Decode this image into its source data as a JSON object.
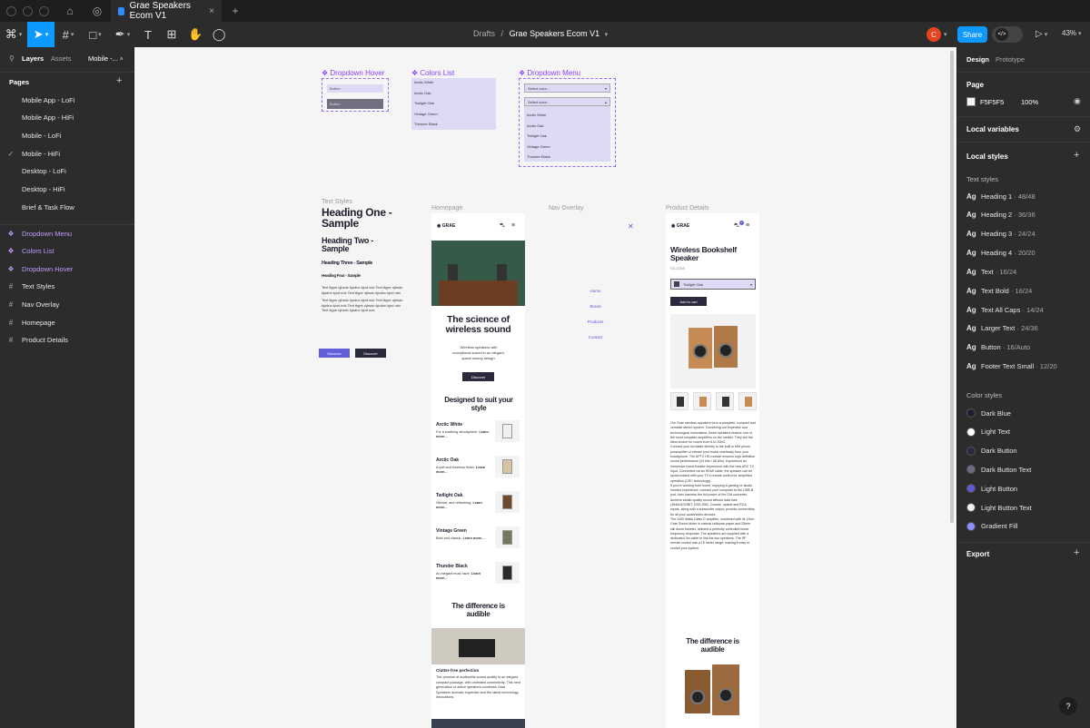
{
  "titlebar": {
    "tab_title": "Grae Speakers Ecom V1"
  },
  "toolbar": {
    "breadcrumb_parent": "Drafts",
    "breadcrumb_sep": "/",
    "file_name": "Grae Speakers Ecom V1",
    "avatar": "C",
    "share": "Share",
    "zoom": "43%"
  },
  "left": {
    "tabs": [
      "Layers",
      "Assets"
    ],
    "page_select": "Mobile -...",
    "pages_title": "Pages",
    "pages": [
      "Mobile App - LoFi",
      "Mobile App - HiFi",
      "Mobile - LoFi",
      "Mobile - HiFi",
      "Desktop - LoFi",
      "Desktop - HiFi",
      "Brief & Task Flow"
    ],
    "check": "✓",
    "layers": [
      {
        "label": "Dropdown Menu",
        "icon": "component-icon",
        "glyph": "❖",
        "purple": true
      },
      {
        "label": "Colors List",
        "icon": "component-icon",
        "glyph": "❖",
        "purple": true
      },
      {
        "label": "Dropdown Hover",
        "icon": "component-icon",
        "glyph": "❖",
        "purple": true
      },
      {
        "label": "Text Styles",
        "icon": "frame-icon",
        "glyph": "#",
        "purple": false
      },
      {
        "label": "Nav Overlay",
        "icon": "frame-icon",
        "glyph": "#",
        "purple": false
      },
      {
        "label": "Homepage",
        "icon": "frame-icon",
        "glyph": "#",
        "purple": false
      },
      {
        "label": "Product Details",
        "icon": "frame-icon",
        "glyph": "#",
        "purple": false
      }
    ]
  },
  "right": {
    "tabs": [
      "Design",
      "Prototype"
    ],
    "page_title": "Page",
    "page_color": "F5F5F5",
    "page_opacity": "100%",
    "local_variables": "Local variables",
    "local_styles": "Local styles",
    "text_styles_title": "Text styles",
    "text_styles": [
      {
        "name": "Heading 1",
        "spec": "48/48"
      },
      {
        "name": "Heading 2",
        "spec": "36/36"
      },
      {
        "name": "Heading 3",
        "spec": "24/24"
      },
      {
        "name": "Heading 4",
        "spec": "20/20"
      },
      {
        "name": "Text",
        "spec": "16/24"
      },
      {
        "name": "Text Bold",
        "spec": "16/24"
      },
      {
        "name": "Text All Caps",
        "spec": "14/24"
      },
      {
        "name": "Larger Text",
        "spec": "24/36"
      },
      {
        "name": "Button",
        "spec": "16/Auto"
      },
      {
        "name": "Footer Text Small",
        "spec": "12/20"
      }
    ],
    "ag": "Ag",
    "color_styles_title": "Color styles",
    "color_styles": [
      {
        "name": "Dark Blue",
        "color": "#1e1e2e"
      },
      {
        "name": "Light Text",
        "color": "#ffffff"
      },
      {
        "name": "Dark Button",
        "color": "#2a2a3c"
      },
      {
        "name": "Dark Button Text",
        "color": "#6b6b80"
      },
      {
        "name": "Light Button",
        "color": "#5b5bd6"
      },
      {
        "name": "Light Button Text",
        "color": "#f0f0f5"
      },
      {
        "name": "Gradient Fill",
        "color": "#8d8dff"
      }
    ],
    "export": "Export",
    "help": "?"
  },
  "canvas": {
    "components": {
      "dropdown_hover": "Dropdown Hover",
      "colors_list": "Colors List",
      "dropdown_menu": "Dropdown Menu",
      "button": "Button",
      "colors": [
        "Arctic White",
        "Arctic Oak",
        "Twilight Oak",
        "Vintage Green",
        "Thunder Black"
      ],
      "select": "Select color..."
    },
    "frames": {
      "text_styles": "Text Styles",
      "homepage": "Homepage",
      "nav_overlay": "Nav Overlay",
      "product_details": "Product Details"
    },
    "text_styles": {
      "h1": "Heading One - Sample",
      "h2": "Heading Two - Sample",
      "h3": "Heading Three - Sample",
      "h4": "Heading Four - Sample",
      "body1": "Text ttype ujhsdc kjudnc kjnd ndc Text ttype ujhsdc kjudnc kjnd ndc Text ttype ujhsdc kjudnc kjnd ndc",
      "body2": "Text ttype ujhsdc kjudnc kjnd ndc Text ttype ujhsdc kjudnc kjnd ndc Text ttype ujhsdc kjudnc kjnd ndc Text ttype ujhsdc kjudnc kjnd ndc",
      "btn": "Discover"
    },
    "home": {
      "logo": "GRAE",
      "hero_title": "The science of wireless sound",
      "hero_text": "Wireless speakers with exceptional sound in an elegant, space saving design.",
      "cta": "Discover",
      "section_title": "Designed to suit your style",
      "products": [
        {
          "name": "Arctic White",
          "desc": "For a soothing atmosphere.",
          "link": "Learn more..."
        },
        {
          "name": "Arctic Oak",
          "desc": "A soft and timeless finish.",
          "link": "Learn more..."
        },
        {
          "name": "Twilight Oak",
          "desc": "Vibrant, and refreshing.",
          "link": "Learn more..."
        },
        {
          "name": "Vintage Green",
          "desc": "Bold and classic.",
          "link": "Learn more..."
        },
        {
          "name": "Thunder Black",
          "desc": "An elegant must have.",
          "link": "Learn more..."
        }
      ],
      "diff_title": "The difference is audible",
      "feature_title": "Clutter-free perfection",
      "feature_text": "The promise of audiophile sound quality in an elegant, compact package, with unlimited connectivity. This next generation of active speakers combines Grae Speakers acoustic expertise and the latest technology innovations."
    },
    "nav": {
      "close": "✕",
      "items": [
        "Home",
        "Brand",
        "Products",
        "Contact"
      ]
    },
    "product": {
      "logo": "GRAE",
      "cart_count": "0",
      "title": "Wireless Bookshelf Speaker",
      "sku": "GS-12345",
      "select": "Twilight Oak",
      "add": "Add to cart",
      "p1": "Our Grae wireless speakers form a complete, compact and versatile stereo system. Combining our expertise and technological innovations, these speakers feature one of the most complete amplifiers on the market. They are the ideal choice for rooms from 8 to 20m2.",
      "p2": "Connect your turntable directly to the built in MM phono preamplifier or stream your music wirelessly from your smartphone. The APTX HD module ensures high definition sound performance (24 bits / 48 kHz). Experience an immersive home theater experience with the new ARC TV input. Connected via an HDMI cable, the speaker can be synchronized with your TV's remote control for simplified operation (CEC technology).",
      "p3": "If you're working from home, enjoying a gaming or studio monitor experience, connect your computer to the USB-B port, then harness the full power of the D/A converter. Achieve studio-quality sound without data loss (384kHZ/32BIT, DSD 256). Coaxial, optical and RCA inputs, along with a subwoofer output, provide connectivity for all your audio/video devices.",
      "p4": "The 2x50 Watts Class D amplifier, combined with its 13cm Grae Sound driver in natural cellulose paper and 25mm silk dome tweeter, delivers a perfectly controlled linear frequency response. The speakers are supplied with a dedicated 3m cable to link the two speakers. The RF remote control has a 15 meter range, making it easy to control your system.",
      "diff_title": "The difference is audible"
    }
  }
}
